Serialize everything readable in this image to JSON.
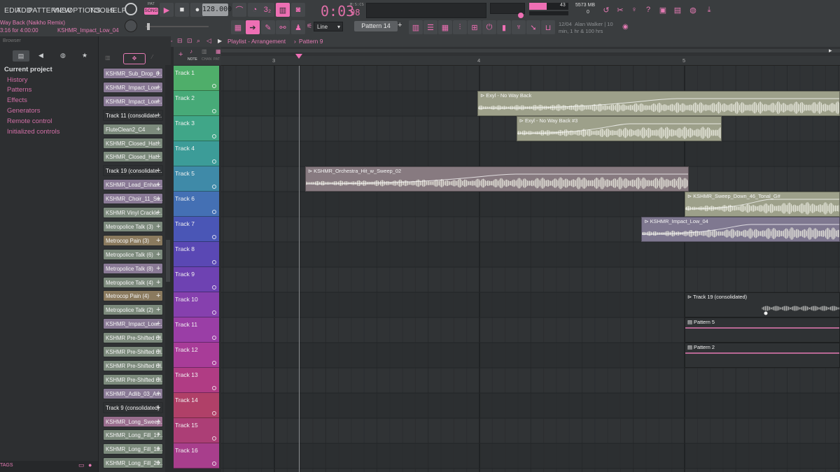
{
  "menu": [
    "EDIT",
    "ADD",
    "PATTERNS",
    "VIEW",
    "OPTIONS",
    "TOOLS",
    "HELP"
  ],
  "transport": {
    "mode_pat": "PAT",
    "mode_song": "SONG",
    "tempo": "128.000",
    "time": "0:03",
    "time_ms": "98",
    "time_unit": "M:S:CS"
  },
  "project": {
    "title": "Way Back (Naikho Remix)",
    "position": "3:16 for 4:00:00",
    "hint": "KSHMR_Impact_Low_04"
  },
  "monitor": {
    "cpu": "43",
    "memory": "5573 MB",
    "polyphony": "0"
  },
  "news": {
    "date": "12/04",
    "artist": "Alan Walker | 10",
    "detail": "min, 1 hr & 100 hrs"
  },
  "toolbar2": {
    "snap": "Line",
    "pattern": "Pattern 14"
  },
  "browser": {
    "title": "Browser",
    "items": [
      "Current project",
      "History",
      "Patterns",
      "Effects",
      "Generators",
      "Remote control",
      "Initialized controls"
    ],
    "tags_label": "TAGS"
  },
  "playlist": {
    "title": "Playlist - Arrangement",
    "pattern": "Pattern 9",
    "ruler": [
      "3",
      "4",
      "5"
    ],
    "tab_note": "NOTE",
    "tab_chan": "CHAN",
    "tab_pat": "PAT"
  },
  "channels": [
    {
      "name": "KSHMR_Sub_Drop_0...",
      "color": "#8a7a96"
    },
    {
      "name": "KSHMR_Impact_Low...",
      "color": "#8a7a96"
    },
    {
      "name": "KSHMR_Impact_Low...",
      "color": "#8a7a96"
    },
    {
      "name": "Track 11 (consolidate...",
      "color": "#2f3133"
    },
    {
      "name": "FluteClean2_C4",
      "color": "#7c8a7c"
    },
    {
      "name": "KSHMR_Closed_Hat...",
      "color": "#7c8a7c"
    },
    {
      "name": "KSHMR_Closed_Hat...",
      "color": "#7c8a7c"
    },
    {
      "name": "Track 19 (consolidate...",
      "color": "#2f3133"
    },
    {
      "name": "KSHMR_Lead_Enhan...",
      "color": "#8a7a96"
    },
    {
      "name": "KSHMR_Choir_11_Su...",
      "color": "#8a7a96"
    },
    {
      "name": "KSHMR Vinyl Crackle...",
      "color": "#7c8a7c"
    },
    {
      "name": "Metropolice Talk (3)",
      "color": "#7c8a7c"
    },
    {
      "name": "Metrocop Pain (3)",
      "color": "#8a7a5e"
    },
    {
      "name": "Metropolice Talk (6)",
      "color": "#7c8a7c"
    },
    {
      "name": "Metropolice Talk (8)",
      "color": "#8a7a96"
    },
    {
      "name": "Metropolice Talk (4)",
      "color": "#7c8a7c"
    },
    {
      "name": "Metrocop Pain (4)",
      "color": "#8a7a5e"
    },
    {
      "name": "Metropolice Talk (2)",
      "color": "#7c8a7c"
    },
    {
      "name": "KSHMR_Impact_Low...",
      "color": "#8a7a96"
    },
    {
      "name": "KSHMR Pre-Shifted Cl...",
      "color": "#7c8a7c"
    },
    {
      "name": "KSHMR Pre-Shifted Cl...",
      "color": "#7c8a7c"
    },
    {
      "name": "KSHMR Pre-Shifted Cl...",
      "color": "#7c8a7c"
    },
    {
      "name": "KSHMR Pre-Shifted Cl...",
      "color": "#7c8a7c"
    },
    {
      "name": "KSHMR_Adlib_03_Am",
      "color": "#8a7a96"
    },
    {
      "name": "Track 9 (consolidated)",
      "color": "#2f3133"
    },
    {
      "name": "KSHMR_Long_Sweep...",
      "color": "#9a6e8e"
    },
    {
      "name": "KSHMR_Long_Fill_17...",
      "color": "#7c8a7c"
    },
    {
      "name": "KSHMR_Long_Fill_18...",
      "color": "#7c8a7c"
    },
    {
      "name": "KSHMR_Long_Fill_20...",
      "color": "#7c8a7c"
    }
  ],
  "tracks": [
    {
      "name": "Track 1",
      "color": "#4fae6a"
    },
    {
      "name": "Track 2",
      "color": "#47aa78"
    },
    {
      "name": "Track 3",
      "color": "#40a688"
    },
    {
      "name": "Track 4",
      "color": "#3c9c98"
    },
    {
      "name": "Track 5",
      "color": "#3f8aa8"
    },
    {
      "name": "Track 6",
      "color": "#4470b4"
    },
    {
      "name": "Track 7",
      "color": "#4a56b6"
    },
    {
      "name": "Track 8",
      "color": "#5a48b4"
    },
    {
      "name": "Track 9",
      "color": "#6e42b2"
    },
    {
      "name": "Track 10",
      "color": "#8640ae"
    },
    {
      "name": "Track 11",
      "color": "#9a3ea6"
    },
    {
      "name": "Track 12",
      "color": "#a83c98"
    },
    {
      "name": "Track 13",
      "color": "#b03c84"
    },
    {
      "name": "Track 14",
      "color": "#b04068"
    },
    {
      "name": "Track 15",
      "color": "#ac3e76"
    },
    {
      "name": "Track 16",
      "color": "#a83e8c"
    }
  ],
  "clips": [
    {
      "name": "Exyl - No Way Back",
      "track": 2,
      "start": 3.99,
      "end": 5.76,
      "color": "#9da08a",
      "kind": "audio"
    },
    {
      "name": "Exyl - No Way Back #3",
      "track": 3,
      "start": 4.18,
      "end": 5.18,
      "color": "#9da08a",
      "kind": "audio"
    },
    {
      "name": "KSHMR_Orchestra_Hit_w_Sweep_02",
      "track": 5,
      "start": 3.15,
      "end": 5.02,
      "color": "#877a80",
      "kind": "audio"
    },
    {
      "name": "KSHMR_Sweep_Down_46_Tonal_G#",
      "track": 6,
      "start": 5.0,
      "end": 5.76,
      "color": "#9da08a",
      "kind": "audio"
    },
    {
      "name": "KSHMR_Impact_Low_04",
      "track": 7,
      "start": 4.79,
      "end": 5.76,
      "color": "#7f7890",
      "kind": "audio"
    },
    {
      "name": "Track 19 (consolidated)",
      "track": 10,
      "start": 5.0,
      "end": 5.76,
      "color": "#2f3234",
      "kind": "consolidated"
    },
    {
      "name": "Pattern 5",
      "track": 11,
      "start": 5.0,
      "end": 5.76,
      "color": "#2f3234",
      "kind": "pattern"
    },
    {
      "name": "Pattern 2",
      "track": 12,
      "start": 5.0,
      "end": 5.76,
      "color": "#2f3234",
      "kind": "pattern"
    }
  ],
  "playhead": 3.12
}
